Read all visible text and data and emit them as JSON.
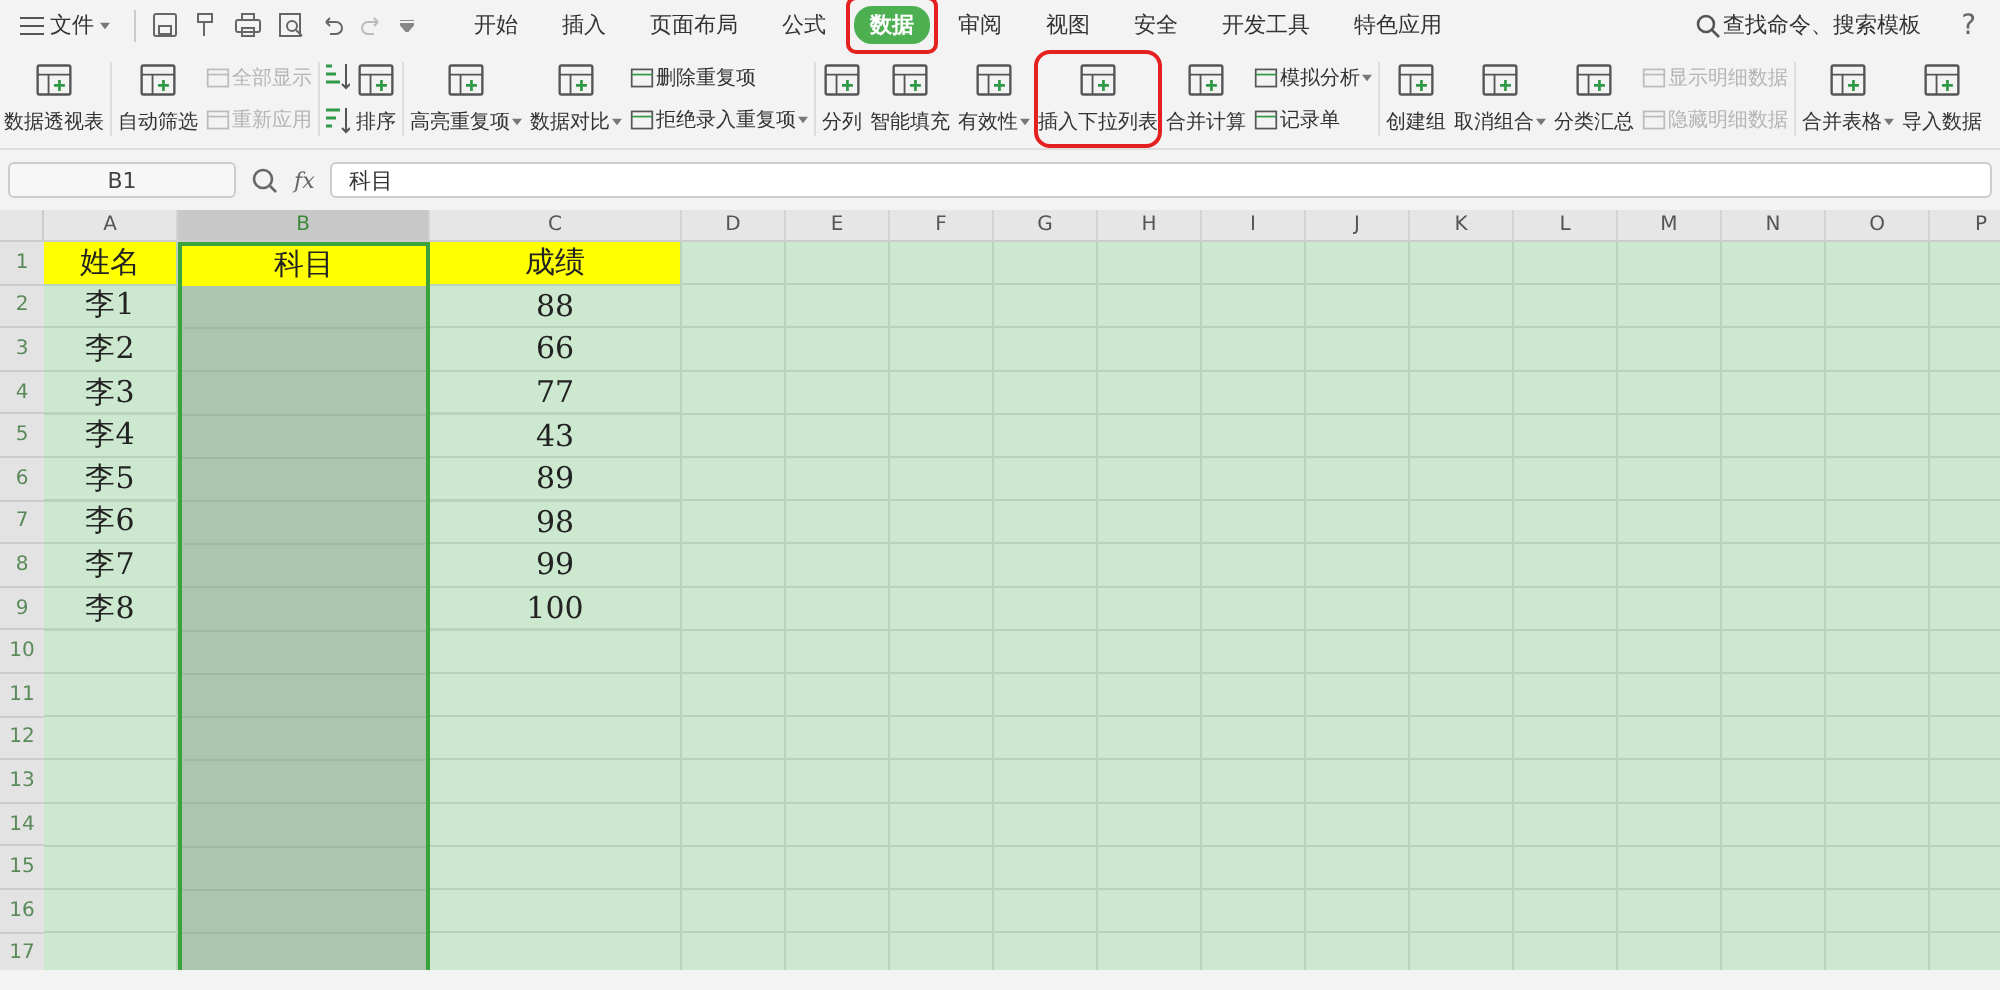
{
  "menu": {
    "file": "文件",
    "tabs": [
      {
        "label": "开始",
        "selected": false,
        "highlighted": false
      },
      {
        "label": "插入",
        "selected": false,
        "highlighted": false
      },
      {
        "label": "页面布局",
        "selected": false,
        "highlighted": false
      },
      {
        "label": "公式",
        "selected": false,
        "highlighted": false
      },
      {
        "label": "数据",
        "selected": true,
        "highlighted": true
      },
      {
        "label": "审阅",
        "selected": false,
        "highlighted": false
      },
      {
        "label": "视图",
        "selected": false,
        "highlighted": false
      },
      {
        "label": "安全",
        "selected": false,
        "highlighted": false
      },
      {
        "label": "开发工具",
        "selected": false,
        "highlighted": false
      },
      {
        "label": "特色应用",
        "selected": false,
        "highlighted": false
      }
    ],
    "search": "查找命令、搜索模板",
    "help": "?"
  },
  "ribbon": {
    "groups": [
      [
        {
          "kind": "large",
          "label": "数据透视表",
          "dropdown": false,
          "highlighted": false
        }
      ],
      [
        {
          "kind": "large",
          "label": "自动筛选",
          "dropdown": false,
          "highlighted": false
        },
        {
          "kind": "stack",
          "items": [
            {
              "label": "全部显示",
              "disabled": true,
              "dropdown": false
            },
            {
              "label": "重新应用",
              "disabled": true,
              "dropdown": false
            }
          ]
        }
      ],
      [
        {
          "kind": "sort",
          "items": [
            {
              "kind": "ascending"
            },
            {
              "kind": "descending"
            }
          ]
        },
        {
          "kind": "large",
          "label": "排序",
          "dropdown": false,
          "highlighted": false
        }
      ],
      [
        {
          "kind": "large",
          "label": "高亮重复项",
          "dropdown": true,
          "highlighted": false
        },
        {
          "kind": "large",
          "label": "数据对比",
          "dropdown": true,
          "highlighted": false
        },
        {
          "kind": "stack",
          "items": [
            {
              "label": "删除重复项",
              "disabled": false,
              "dropdown": false
            },
            {
              "label": "拒绝录入重复项",
              "disabled": false,
              "dropdown": true
            }
          ]
        }
      ],
      [
        {
          "kind": "large",
          "label": "分列",
          "dropdown": false,
          "highlighted": false
        },
        {
          "kind": "large",
          "label": "智能填充",
          "dropdown": false,
          "highlighted": false
        },
        {
          "kind": "large",
          "label": "有效性",
          "dropdown": true,
          "highlighted": false
        },
        {
          "kind": "large",
          "label": "插入下拉列表",
          "dropdown": false,
          "highlighted": true
        },
        {
          "kind": "large",
          "label": "合并计算",
          "dropdown": false,
          "highlighted": false
        },
        {
          "kind": "stack",
          "items": [
            {
              "label": "模拟分析",
              "disabled": false,
              "dropdown": true
            },
            {
              "label": "记录单",
              "disabled": false,
              "dropdown": false
            }
          ]
        }
      ],
      [
        {
          "kind": "large",
          "label": "创建组",
          "dropdown": false,
          "highlighted": false
        },
        {
          "kind": "large",
          "label": "取消组合",
          "dropdown": true,
          "highlighted": false
        },
        {
          "kind": "large",
          "label": "分类汇总",
          "dropdown": false,
          "highlighted": false
        },
        {
          "kind": "stack",
          "items": [
            {
              "label": "显示明细数据",
              "disabled": true,
              "dropdown": false
            },
            {
              "label": "隐藏明细数据",
              "disabled": true,
              "dropdown": false
            }
          ]
        }
      ],
      [
        {
          "kind": "large",
          "label": "合并表格",
          "dropdown": true,
          "highlighted": false
        },
        {
          "kind": "large",
          "label": "导入数据",
          "dropdown": false,
          "highlighted": false
        }
      ]
    ]
  },
  "formula_bar": {
    "cell_reference": "B1",
    "fx": "fx",
    "value": "科目"
  },
  "sheet": {
    "columns": [
      {
        "label": "A",
        "selected": false
      },
      {
        "label": "B",
        "selected": true
      },
      {
        "label": "C",
        "selected": false
      },
      {
        "label": "D",
        "selected": false
      },
      {
        "label": "E",
        "selected": false
      },
      {
        "label": "F",
        "selected": false
      },
      {
        "label": "G",
        "selected": false
      },
      {
        "label": "H",
        "selected": false
      },
      {
        "label": "I",
        "selected": false
      },
      {
        "label": "J",
        "selected": false
      },
      {
        "label": "K",
        "selected": false
      },
      {
        "label": "L",
        "selected": false
      },
      {
        "label": "M",
        "selected": false
      },
      {
        "label": "N",
        "selected": false
      },
      {
        "label": "O",
        "selected": false
      },
      {
        "label": "P",
        "selected": false
      }
    ],
    "rows": [
      {
        "number": "1",
        "kind": "header",
        "name": "姓名",
        "subject": "科目",
        "score": "成绩"
      },
      {
        "number": "2",
        "kind": "data",
        "name": "李1",
        "score": "88"
      },
      {
        "number": "3",
        "kind": "data",
        "name": "李2",
        "score": "66"
      },
      {
        "number": "4",
        "kind": "data",
        "name": "李3",
        "score": "77"
      },
      {
        "number": "5",
        "kind": "data",
        "name": "李4",
        "score": "43"
      },
      {
        "number": "6",
        "kind": "data",
        "name": "李5",
        "score": "89"
      },
      {
        "number": "7",
        "kind": "data",
        "name": "李6",
        "score": "98"
      },
      {
        "number": "8",
        "kind": "data",
        "name": "李7",
        "score": "99"
      },
      {
        "number": "9",
        "kind": "data",
        "name": "李8",
        "score": "100"
      },
      {
        "number": "10",
        "kind": "data"
      },
      {
        "number": "11",
        "kind": "data"
      },
      {
        "number": "12",
        "kind": "data"
      },
      {
        "number": "13",
        "kind": "data"
      },
      {
        "number": "14",
        "kind": "data"
      },
      {
        "number": "15",
        "kind": "data"
      },
      {
        "number": "16",
        "kind": "data"
      },
      {
        "number": "17",
        "kind": "data"
      }
    ]
  }
}
